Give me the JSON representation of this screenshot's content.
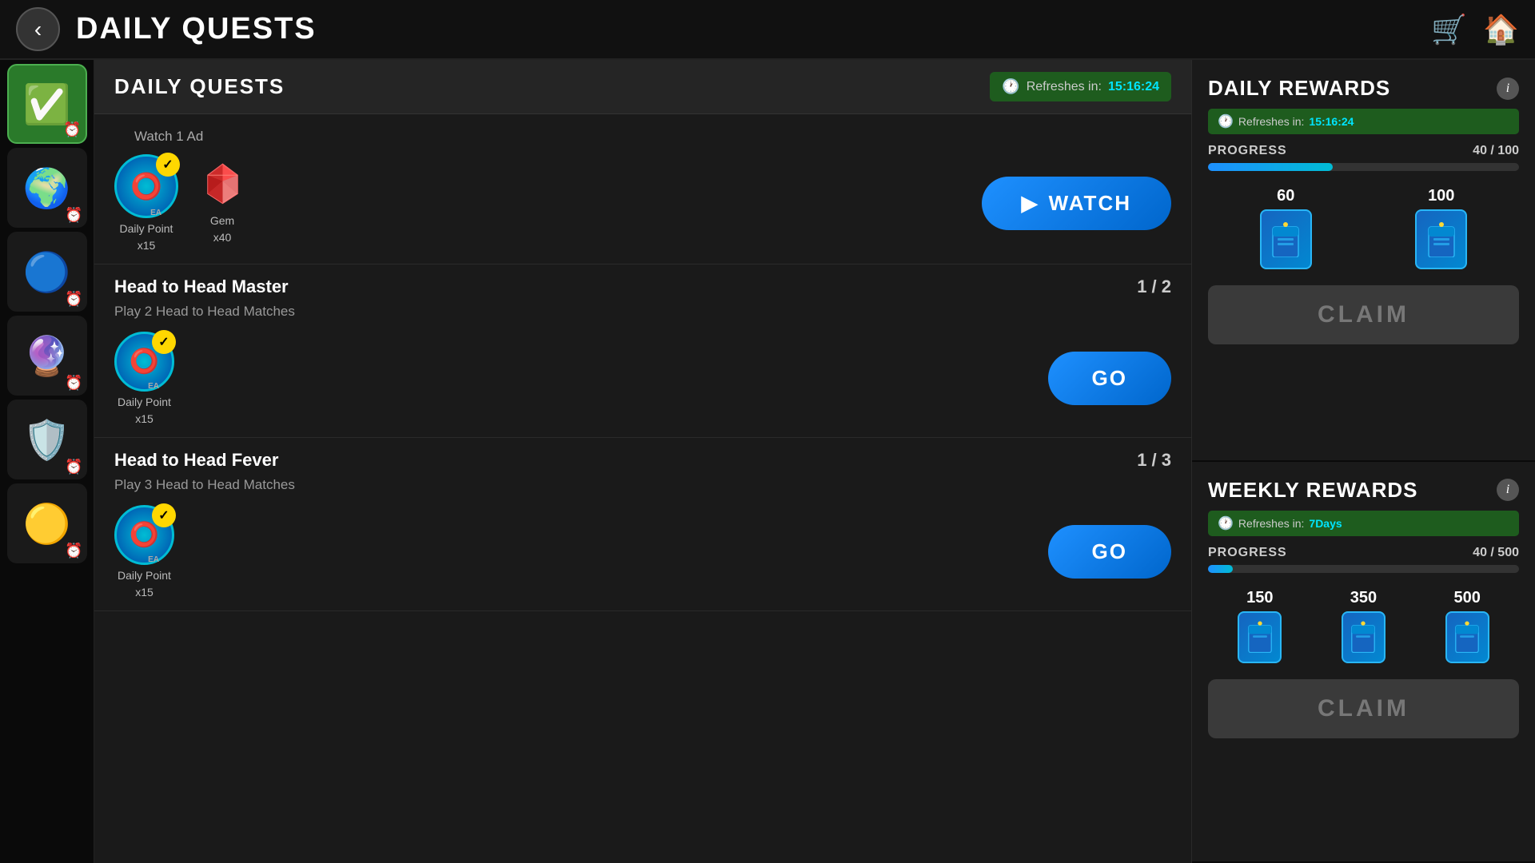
{
  "header": {
    "title": "DAILY QUESTS",
    "back_label": "‹",
    "cart_icon": "🛒",
    "home_icon": "🏠"
  },
  "sidebar": {
    "items": [
      {
        "id": "quest",
        "icon": "✅",
        "active": true
      },
      {
        "id": "planet",
        "icon": "🌍",
        "active": false
      },
      {
        "id": "globe",
        "icon": "🔵",
        "active": false
      },
      {
        "id": "purple-orb",
        "icon": "🔮",
        "active": false
      },
      {
        "id": "shield",
        "icon": "🛡️",
        "active": false
      },
      {
        "id": "coin",
        "icon": "🟡",
        "active": false
      }
    ]
  },
  "daily_quests": {
    "title": "DAILY QUESTS",
    "refresh_label": "Refreshes in:",
    "refresh_time": "15:16:24",
    "quest_subtitle": "Watch 1 Ad",
    "quests": [
      {
        "id": "watch-ad",
        "subtitle": "Watch 1 Ad",
        "rewards": [
          {
            "type": "daily-point",
            "label": "Daily Point",
            "quantity": "x15"
          },
          {
            "type": "gem",
            "label": "Gem",
            "quantity": "x40"
          }
        ],
        "action": "WATCH",
        "action_type": "watch"
      },
      {
        "id": "head-to-head-master",
        "name": "Head to Head Master",
        "desc": "Play 2 Head to Head Matches",
        "progress": "1 / 2",
        "rewards": [
          {
            "type": "daily-point",
            "label": "Daily Point",
            "quantity": "x15"
          }
        ],
        "action": "GO",
        "action_type": "go"
      },
      {
        "id": "head-to-head-fever",
        "name": "Head to Head Fever",
        "desc": "Play 3 Head to Head Matches",
        "progress": "1 / 3",
        "rewards": [
          {
            "type": "daily-point",
            "label": "Daily Point",
            "quantity": "x15"
          }
        ],
        "action": "GO",
        "action_type": "go"
      }
    ]
  },
  "daily_rewards": {
    "title": "DAILY REWARDS",
    "refresh_label": "Refreshes in:",
    "refresh_time": "15:16:24",
    "progress_label": "PROGRESS",
    "progress_current": 40,
    "progress_max": 100,
    "progress_display": "40 / 100",
    "milestones": [
      {
        "value": 60
      },
      {
        "value": 100
      }
    ],
    "claim_label": "CLAIM"
  },
  "weekly_rewards": {
    "title": "WEEKLY REWARDS",
    "refresh_label": "Refreshes in:",
    "refresh_time": "7Days",
    "progress_label": "PROGRESS",
    "progress_current": 40,
    "progress_max": 500,
    "progress_display": "40 / 500",
    "milestones": [
      {
        "value": 150
      },
      {
        "value": 350
      },
      {
        "value": 500
      }
    ],
    "claim_label": "CLAIM"
  }
}
